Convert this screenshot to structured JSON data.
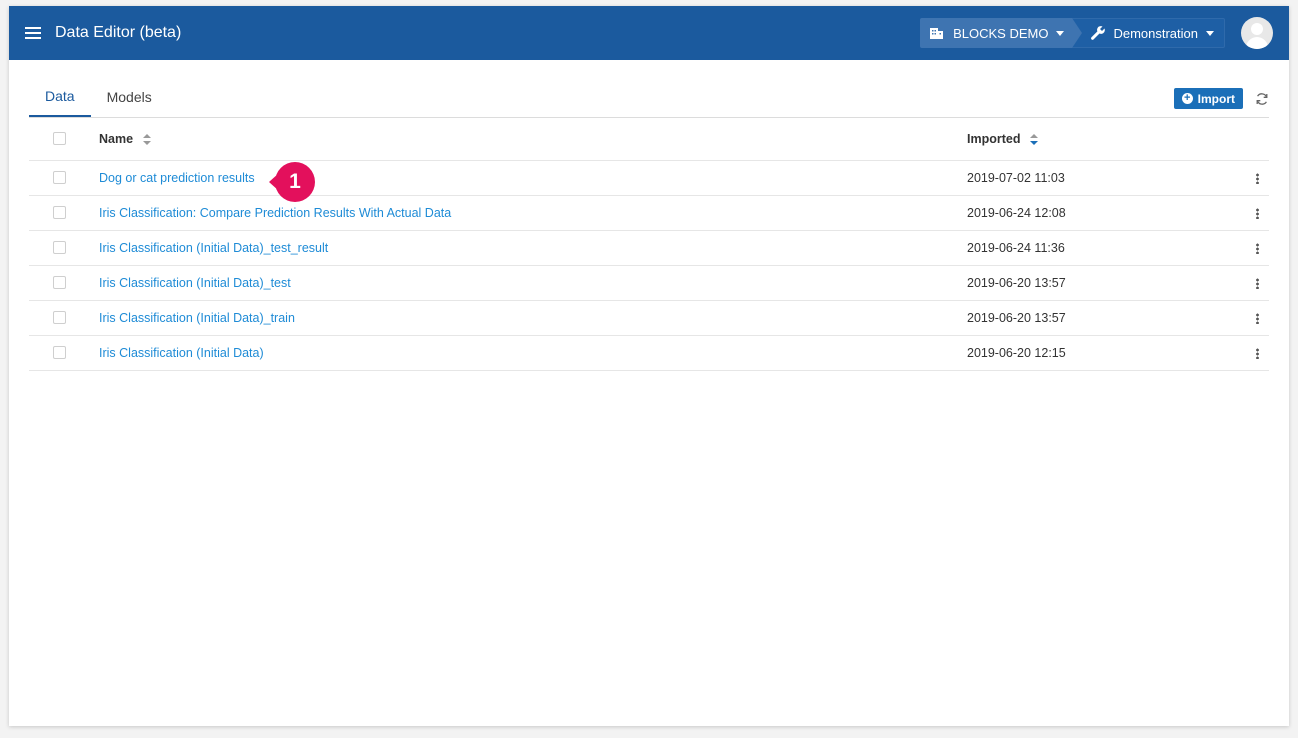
{
  "header": {
    "title": "Data Editor (beta)",
    "org": "BLOCKS DEMO",
    "project": "Demonstration",
    "bg_color": "#1b5a9e"
  },
  "tabs": [
    {
      "label": "Data",
      "active": true
    },
    {
      "label": "Models",
      "active": false
    }
  ],
  "actions": {
    "import_label": "Import"
  },
  "table": {
    "columns": {
      "name": "Name",
      "imported": "Imported"
    },
    "rows": [
      {
        "name": "Dog or cat prediction results",
        "imported": "2019-07-02 11:03"
      },
      {
        "name": "Iris Classification: Compare Prediction Results With Actual Data",
        "imported": "2019-06-24 12:08"
      },
      {
        "name": "Iris Classification (Initial Data)_test_result",
        "imported": "2019-06-24 11:36"
      },
      {
        "name": "Iris Classification (Initial Data)_test",
        "imported": "2019-06-20 13:57"
      },
      {
        "name": "Iris Classification (Initial Data)_train",
        "imported": "2019-06-20 13:57"
      },
      {
        "name": "Iris Classification (Initial Data)",
        "imported": "2019-06-20 12:15"
      }
    ]
  },
  "callout": {
    "number": "1",
    "color": "#e3105c"
  }
}
